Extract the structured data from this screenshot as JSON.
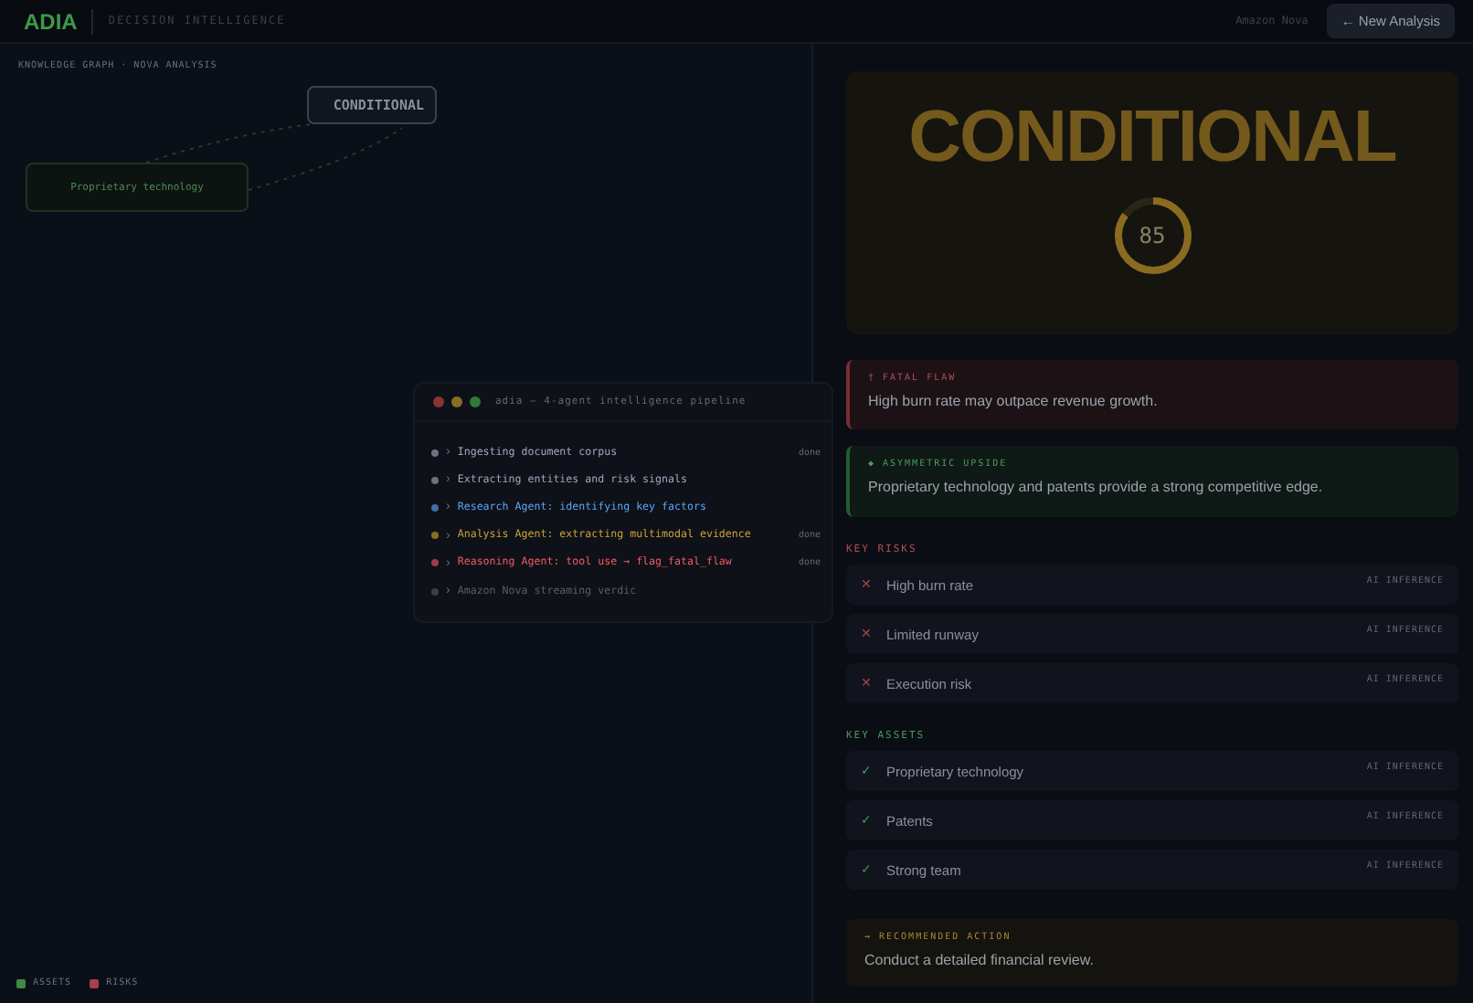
{
  "header": {
    "logo": "ADIA",
    "subtitle": "DECISION INTELLIGENCE",
    "model": "Amazon Nova",
    "new_button": "← New Analysis"
  },
  "graph": {
    "breadcrumb": "KNOWLEDGE GRAPH · NOVA ANALYSIS",
    "nodes": [
      {
        "label": "CONDITIONAL",
        "kind": "verdict"
      },
      {
        "label": "Proprietary technology",
        "kind": "asset"
      }
    ],
    "legend": [
      {
        "label": "ASSETS",
        "color": "#3f8a45"
      },
      {
        "label": "RISKS",
        "color": "#a8404a"
      }
    ]
  },
  "terminal": {
    "title": "adia — 4-agent intelligence pipeline",
    "prompt": "›",
    "steps": [
      {
        "text": "Ingesting document corpus",
        "color": "#6b7180",
        "status": "done"
      },
      {
        "text": "Extracting entities and risk signals",
        "color": "#6b7180"
      },
      {
        "text": "Research Agent: identifying key factors",
        "color": "#3d6fa8"
      },
      {
        "text": "Analysis Agent: extracting multimodal evidence",
        "color": "#8a6d24",
        "status": "done"
      },
      {
        "text": "Reasoning Agent: tool use → flag_fatal_flaw",
        "color": "#a33c42",
        "status": "done"
      },
      {
        "text": "Amazon Nova streaming verdic",
        "color": "#3a3f4a"
      }
    ]
  },
  "verdict": {
    "label": "CONDITIONAL",
    "score": "85",
    "level": 0.85
  },
  "fatal_flaw": {
    "title": "† FATAL FLAW",
    "text": "High burn rate may outpace revenue growth."
  },
  "upside": {
    "title": "◆ ASYMMETRIC UPSIDE",
    "text": "Proprietary technology and patents provide a strong competitive edge."
  },
  "risks": {
    "heading": "KEY RISKS",
    "items": [
      {
        "mark": "✕",
        "label": "High burn rate",
        "tag": "AI INFERENCE"
      },
      {
        "mark": "✕",
        "label": "Limited runway",
        "tag": "AI INFERENCE"
      },
      {
        "mark": "✕",
        "label": "Execution risk",
        "tag": "AI INFERENCE"
      }
    ]
  },
  "assets": {
    "heading": "KEY ASSETS",
    "items": [
      {
        "mark": "✓",
        "label": "Proprietary technology",
        "tag": "AI INFERENCE"
      },
      {
        "mark": "✓",
        "label": "Patents",
        "tag": "AI INFERENCE"
      },
      {
        "mark": "✓",
        "label": "Strong team",
        "tag": "AI INFERENCE"
      }
    ]
  },
  "action": {
    "title": "→ RECOMMENDED ACTION",
    "text": "Conduct a detailed financial review."
  }
}
